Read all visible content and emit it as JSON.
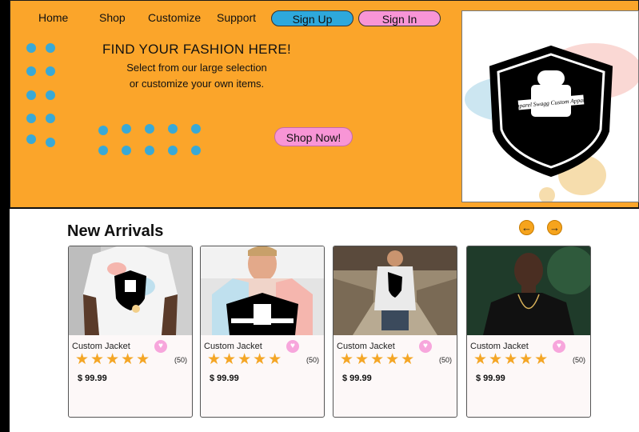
{
  "nav": {
    "links": [
      "Home",
      "Shop",
      "Customize",
      "Support"
    ],
    "signup": "Sign Up",
    "signin": "Sign In"
  },
  "hero": {
    "title": "FIND YOUR FASHION HERE!",
    "subtitle_line1": "Select from our large selection",
    "subtitle_line2": "or customize your own items.",
    "cta": "Shop Now!"
  },
  "brand": {
    "logo_text": "Apparel Swagg Custom Apparel",
    "icon": "hoodie-shield-logo"
  },
  "section": {
    "title": "New Arrivals",
    "prev_icon": "arrow-left-icon",
    "next_icon": "arrow-right-icon"
  },
  "products": [
    {
      "name": "Custom Jacket",
      "rating": 5,
      "reviews": "(50)",
      "price": "$ 99.99"
    },
    {
      "name": "Custom Jacket",
      "rating": 5,
      "reviews": "(50)",
      "price": "$ 99.99"
    },
    {
      "name": "Custom Jacket",
      "rating": 5,
      "reviews": "(50)",
      "price": "$ 99.99"
    },
    {
      "name": "Custom Jacket",
      "rating": 5,
      "reviews": "(50)",
      "price": "$ 99.99"
    }
  ],
  "colors": {
    "hero_bg": "#fba52a",
    "accent_blue": "#2ea8dc",
    "accent_pink": "#f895d6",
    "star": "#f4a626"
  }
}
